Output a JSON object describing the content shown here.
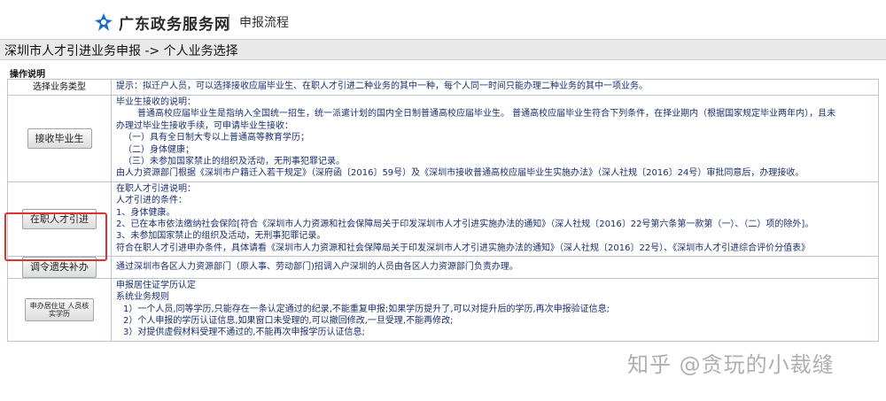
{
  "header": {
    "site_name": "广东政务服务网",
    "page_tag": "申报流程"
  },
  "breadcrumb": "深圳市人才引进业务申报 -> 个人业务选择",
  "section_title": "操作说明",
  "table": {
    "head_label": "选择业务类型",
    "head_tip": "提示：拟迁户人员，可以选择接收应届毕业生、在职人才引进二种业务的其中一种，每个人同一时间只能办理二种业务的其中一项业务。",
    "row1": {
      "button": "接收毕业生",
      "lines": [
        "毕业生接收的说明：",
        "普通高校应届毕业生是指纳入全国统一招生，统一派遣计划的国内全日制普通高校应届毕业生。 普通高校应届毕业生符合下列条件，在择业期内（根据国家规定毕业两年内），且未",
        "办理过毕业生接收手续，可申请毕业生接收：",
        "（一）具有全日制大专以上普通高等教育学历；",
        "（二）身体健康；",
        "（三）未参加国家禁止的组织及活动，无刑事犯罪记录。",
        "由人力资源部门根据《深圳市户籍迁入若干规定》（深府函〔2016〕59号）及《深圳市接收普通高校应届毕业生实施办法》（深人社规〔2016〕24号）审批同意后，办理接收。"
      ]
    },
    "row2": {
      "button": "在职人才引进",
      "lines": [
        "在职人才引进说明：",
        "人才引进的条件：",
        "1、身体健康。",
        "2、已在本市依法缴纳社会保险[符合《深圳市人力资源和社会保障局关于印发深圳市人才引进实施办法的通知》（深人社规〔2016〕22号第六条第一款第（一）、（二）项的除外]。",
        "3、未参加国家禁止的组织及活动，无刑事犯罪记录。",
        "符合在职人才引进申办条件，具体请看《深圳市人力资源和社会保障局关于印发深圳市人才引进实施办法的通知》（深人社规〔2016〕22号）、《深圳市人才引进综合评价分值表》"
      ]
    },
    "row3": {
      "button": "调令遗失补办",
      "text": "通过深圳市各区人力资源部门（原人事、劳动部门)招调入户深圳的人员由各区人力资源部门负责办理。"
    },
    "row4": {
      "button": "申办居住证 人员核实学历",
      "lines": [
        "申报居住证学历认定",
        "系统业务规则",
        "1）一个人员,同等学历,只能存在一条认定通过的纪录,不能重复申报;如果学历提升了,可以对提升后的学历,再次申报验证信息;",
        "2）个人申报的学历认证信息,如果窗口未受理的,可以撤回修改,一旦受理,不能再修改;",
        "3）对提供虚假材料受理不通过的,不能再次申报学历认证信息;"
      ]
    }
  },
  "watermark": "知乎 @贪玩的小裁缝",
  "colors": {
    "link_text": "#1a2f6e",
    "highlight": "#e03030",
    "logo": "#1a6fc0"
  }
}
